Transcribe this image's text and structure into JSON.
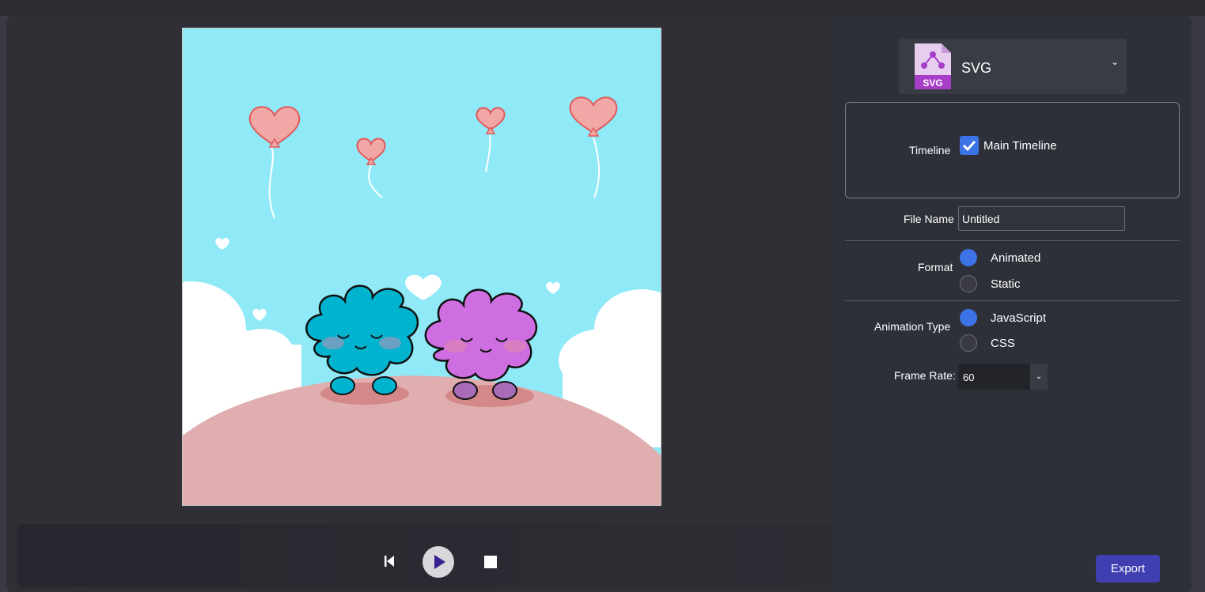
{
  "export_dialog": {
    "format_selector": {
      "value": "SVG",
      "icon": "svg-file-icon"
    },
    "timeline": {
      "label": "Timeline",
      "option_label": "Main Timeline",
      "checked": true
    },
    "file_name": {
      "label": "File Name",
      "value": "Untitled"
    },
    "format": {
      "label": "Format",
      "options": [
        {
          "label": "Animated",
          "selected": true
        },
        {
          "label": "Static",
          "selected": false
        }
      ]
    },
    "animation_type": {
      "label": "Animation Type",
      "options": [
        {
          "label": "JavaScript",
          "selected": true
        },
        {
          "label": "CSS",
          "selected": false
        }
      ]
    },
    "frame_rate": {
      "label": "Frame Rate:",
      "value": "60"
    },
    "export_label": "Export"
  },
  "transport": {
    "prev_icon": "skip-back-icon",
    "play_icon": "play-icon",
    "stop_icon": "stop-icon"
  },
  "colors": {
    "accent": "#3b73e6",
    "export_button": "#3f3fb2",
    "sky": "#8fe9f7",
    "hill": "#e0aeae",
    "creature_blue": "#00b3cf",
    "creature_purple": "#cf6ee0"
  }
}
